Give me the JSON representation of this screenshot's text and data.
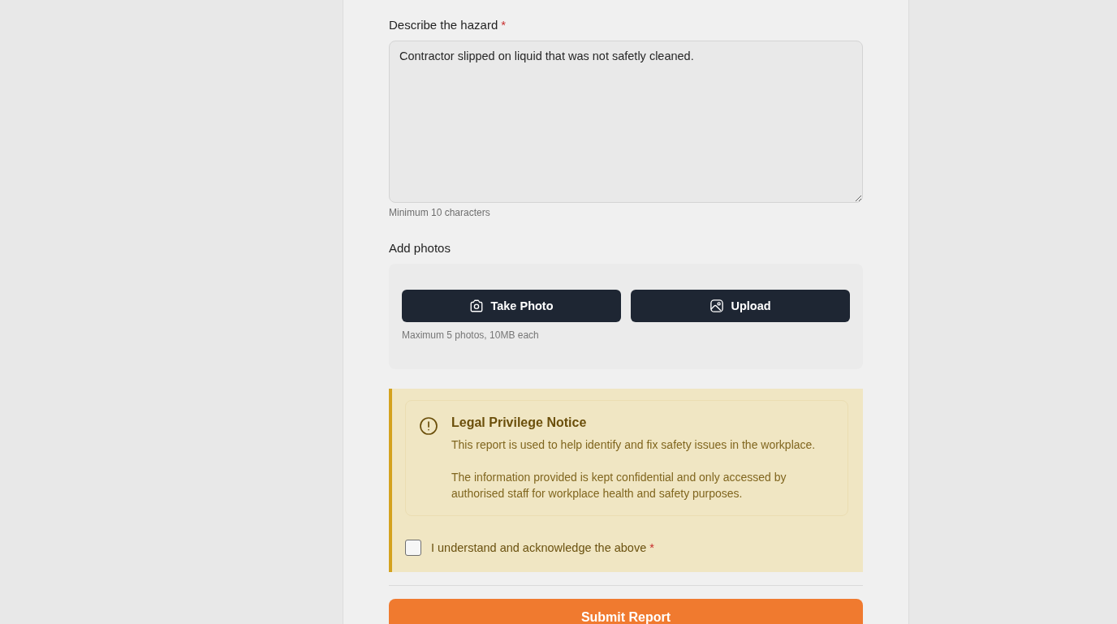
{
  "hazard": {
    "label": "Describe the hazard",
    "required_mark": "*",
    "value": "Contractor slipped on liquid that was not safetly cleaned.",
    "hint": "Minimum 10 characters"
  },
  "photos": {
    "label": "Add photos",
    "buttons": [
      {
        "kind": "camera",
        "label": "Take Photo"
      },
      {
        "kind": "upload",
        "label": "Upload"
      }
    ],
    "hint": "Maximum 5 photos, 10MB each"
  },
  "notice": {
    "title": "Legal Privilege Notice",
    "paragraphs": [
      "This report is used to help identify and fix safety issues in the workplace.",
      "The information provided is kept confidential and only accessed by authorised staff for workplace health and safety purposes."
    ],
    "acknowledge": {
      "label": "I understand and acknowledge the above",
      "required_mark": "*",
      "checked": false
    }
  },
  "submit": {
    "label": "Submit Report"
  }
}
